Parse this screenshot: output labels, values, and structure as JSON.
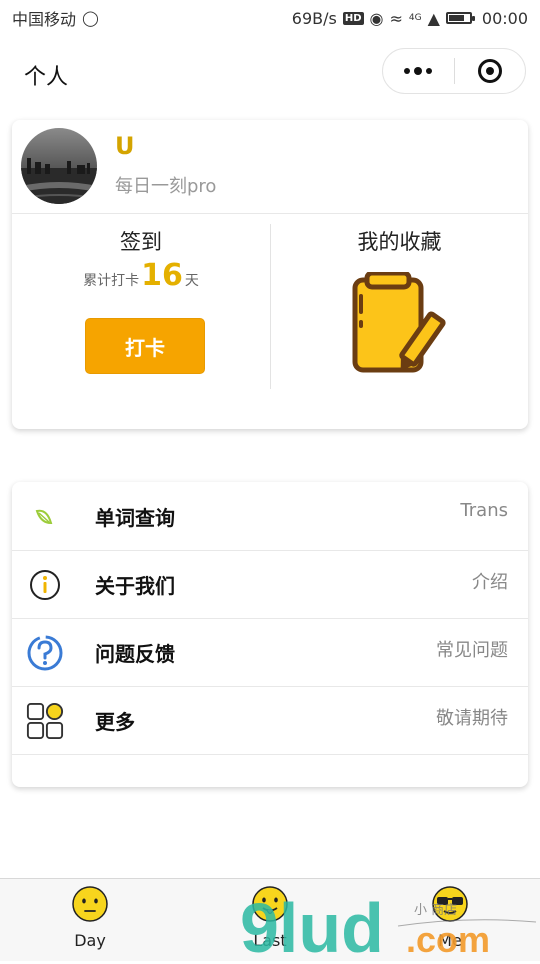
{
  "status_bar": {
    "carrier": "中国移动",
    "speed": "69B/s",
    "hd": "HD",
    "network": "4G",
    "time": "00:00"
  },
  "nav": {
    "title": "个人"
  },
  "profile": {
    "name": "U",
    "subtitle": "每日一刻pro"
  },
  "checkin": {
    "title": "签到",
    "streak_prefix": "累计打卡",
    "streak_days": "16",
    "streak_suffix": "天",
    "button_label": "打卡"
  },
  "favorites": {
    "title": "我的收藏"
  },
  "menu": {
    "items": [
      {
        "label": "单词查询",
        "value": "Trans",
        "icon": "leaf-icon"
      },
      {
        "label": "关于我们",
        "value": "介绍",
        "icon": "info-icon"
      },
      {
        "label": "问题反馈",
        "value": "常见问题",
        "icon": "question-icon"
      },
      {
        "label": "更多",
        "value": "敬请期待",
        "icon": "grid-icon"
      }
    ]
  },
  "tabbar": {
    "tabs": [
      {
        "label": "Day",
        "icon": "neutral-face-icon"
      },
      {
        "label": "Last",
        "icon": "tongue-face-icon"
      },
      {
        "label": "Me",
        "icon": "sunglasses-face-icon"
      }
    ]
  },
  "watermark": {
    "text": "9lud.com",
    "tag": "小 商店"
  },
  "colors": {
    "accent": "#f6a400",
    "name_gold": "#d4a400",
    "streak_gold": "#e4b000",
    "emoji_yellow": "#f7d51d"
  }
}
